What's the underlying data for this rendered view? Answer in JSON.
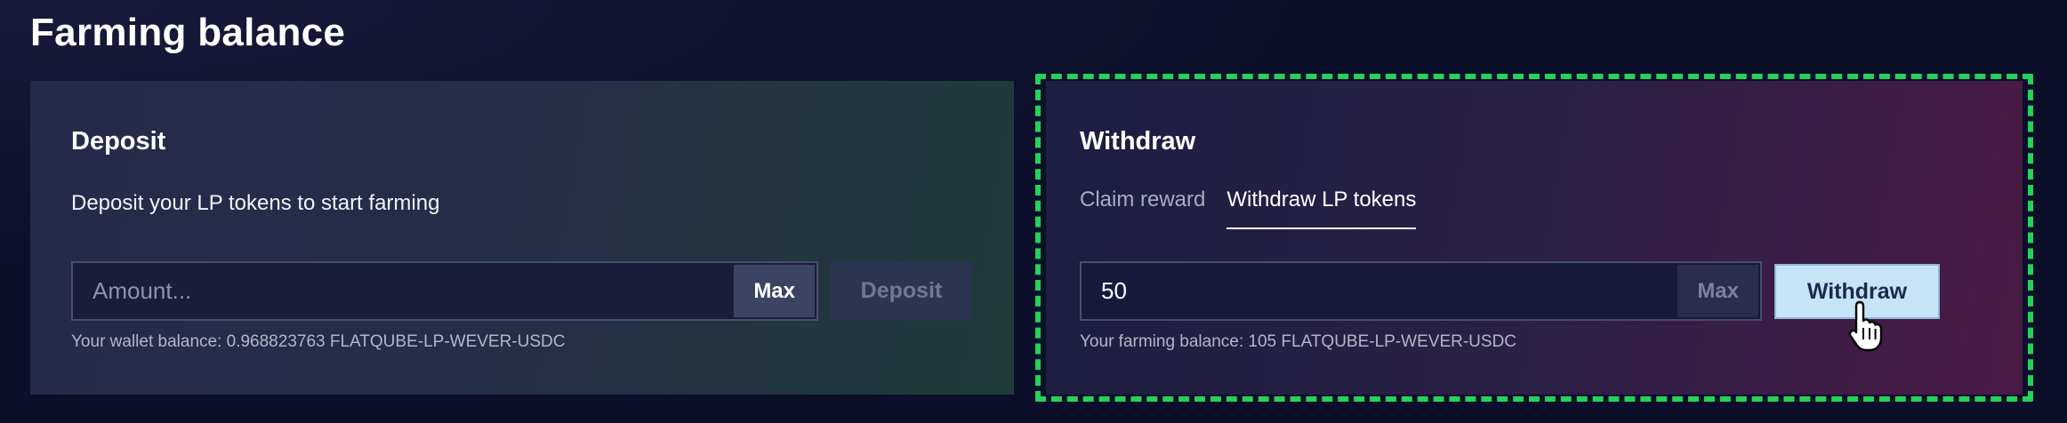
{
  "section": {
    "title": "Farming balance"
  },
  "deposit": {
    "title": "Deposit",
    "description": "Deposit your LP tokens to start farming",
    "amount_placeholder": "Amount...",
    "max_label": "Max",
    "button_label": "Deposit",
    "wallet_balance_text": "Your wallet balance: 0.968823763 FLATQUBE-LP-WEVER-USDC"
  },
  "withdraw": {
    "title": "Withdraw",
    "tabs": [
      {
        "label": "Claim reward",
        "active": false
      },
      {
        "label": "Withdraw LP tokens",
        "active": true
      }
    ],
    "amount_value": "50",
    "max_label": "Max",
    "button_label": "Withdraw",
    "farming_balance_text": "Your farming balance: 105 FLATQUBE-LP-WEVER-USDC"
  },
  "colors": {
    "highlight": "#23d35b",
    "withdraw_button_bg": "#c6e3f7",
    "page_bg": "#0c0f2a"
  },
  "icons": {
    "cursor": "hand-pointer-icon"
  }
}
